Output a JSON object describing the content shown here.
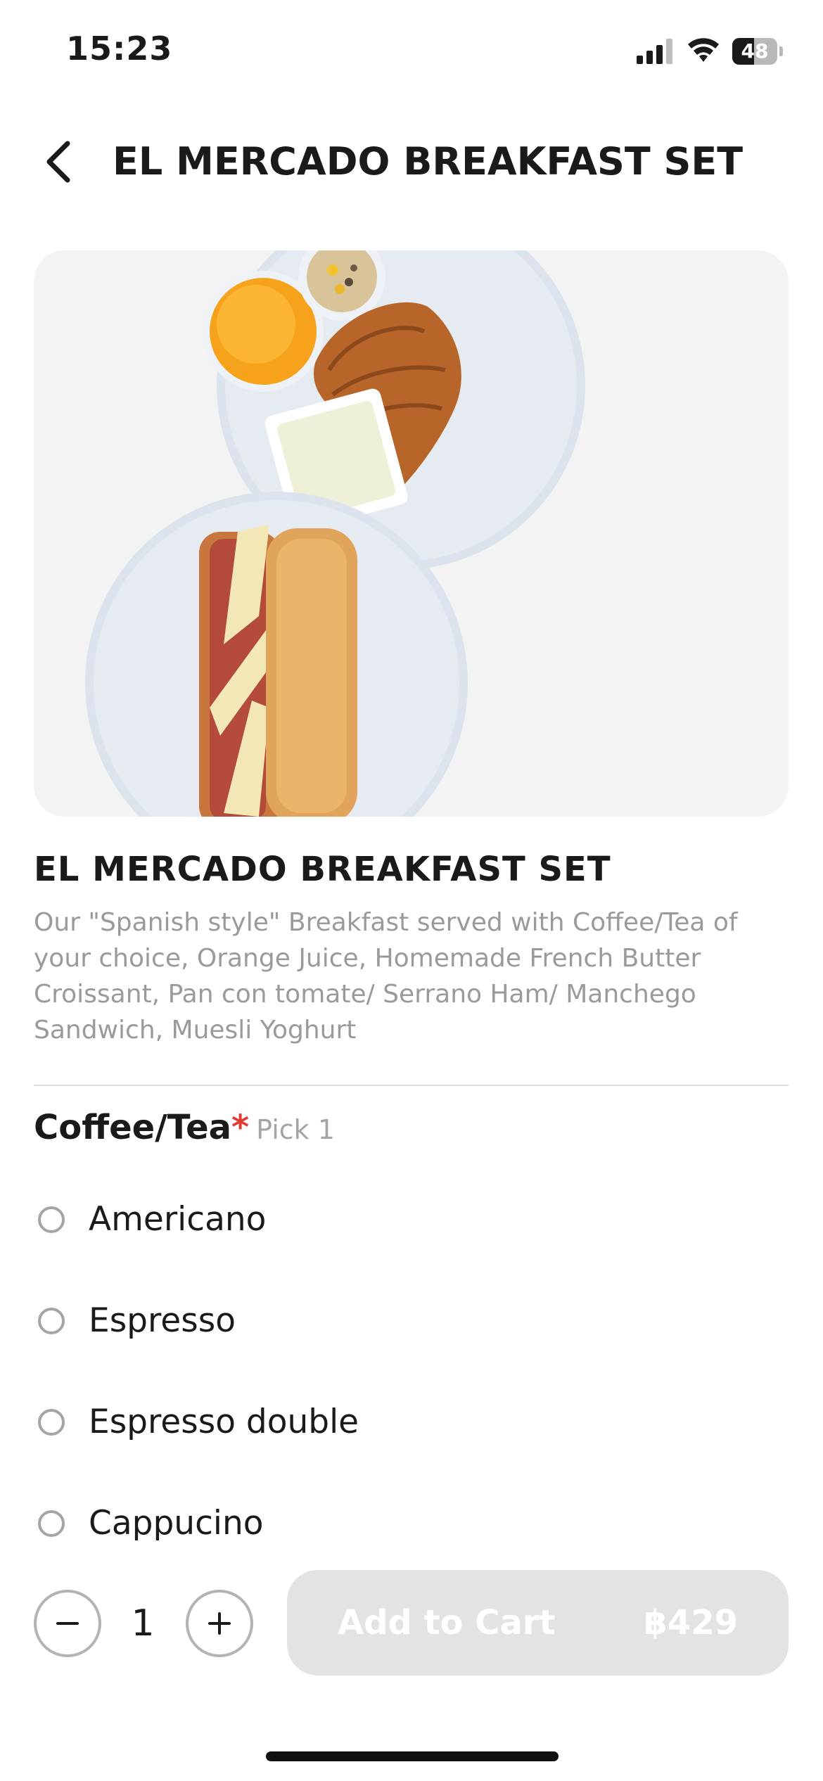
{
  "status_bar": {
    "time": "15:23",
    "battery_level": "48",
    "battery_fraction": 0.48
  },
  "header": {
    "title": "EL MERCADO BREAKFAST SET"
  },
  "product": {
    "title": "EL MERCADO BREAKFAST SET",
    "description": "Our \"Spanish style\" Breakfast served with Coffee/Tea of your choice, Orange Juice, Homemade French Butter Croissant, Pan con tomate/ Serrano Ham/ Manchego Sandwich, Muesli Yoghurt"
  },
  "options_group": {
    "title": "Coffee/Tea",
    "required_mark": "*",
    "hint": "Pick 1",
    "options": [
      {
        "label": "Americano",
        "selected": false
      },
      {
        "label": "Espresso",
        "selected": false
      },
      {
        "label": "Espresso double",
        "selected": false
      },
      {
        "label": "Cappucino",
        "selected": false
      }
    ]
  },
  "cart": {
    "quantity": "1",
    "add_label": "Add to Cart",
    "price": "฿429",
    "enabled": false
  },
  "colors": {
    "required": "#e53935",
    "disabled_button": "#e3e3e3",
    "muted_text": "#9a9a9a"
  }
}
